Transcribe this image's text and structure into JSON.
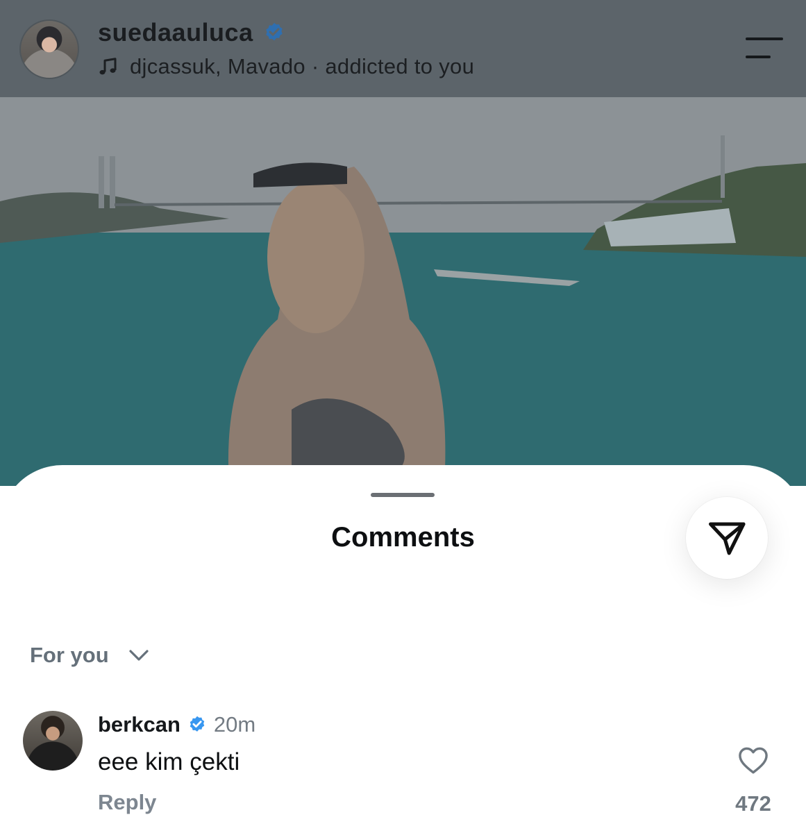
{
  "header": {
    "username": "suedaauluca",
    "music": "djcassuk, Mavado · addicted to you"
  },
  "comments_sheet": {
    "title": "Comments",
    "filter_label": "For you",
    "comments": [
      {
        "username": "berkcan",
        "time": "20m",
        "text": "eee kim çekti",
        "reply_label": "Reply",
        "like_count": "472"
      }
    ]
  },
  "icons": [
    "verified-badge-icon",
    "music-note-icon",
    "menu-icon",
    "send-icon",
    "chevron-down-icon",
    "heart-icon"
  ],
  "colors": {
    "verified": "#3897f0",
    "header_overlay": "#5c646a",
    "muted_text": "#737b83"
  }
}
